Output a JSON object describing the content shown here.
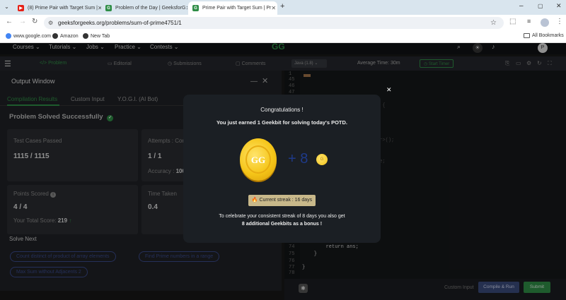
{
  "browser": {
    "tabs": [
      {
        "title": "(8) Prime Pair with Target Sum |",
        "favicon": "youtube-icon",
        "active": false
      },
      {
        "title": "Problem of the Day | GeeksforG",
        "favicon": "gfg-icon",
        "active": false
      },
      {
        "title": "Prime Pair with Target Sum | Pr",
        "favicon": "gfg-icon",
        "active": true
      }
    ],
    "new_tab": "+",
    "url": "geeksforgeeks.org/problems/sum-of-prime4751/1",
    "bookmarks": [
      "www.google.com",
      "Amazon",
      "New Tab"
    ],
    "all_bookmarks": "All Bookmarks"
  },
  "site": {
    "nav": [
      "Courses",
      "Tutorials",
      "Jobs",
      "Practice",
      "Contests"
    ],
    "subtabs": [
      "Problem",
      "Editorial",
      "Submissions",
      "Comments"
    ],
    "output_window": "Output Window",
    "output_tabs": [
      "Compilation Results",
      "Custom Input",
      "Y.O.G.I. (AI Bot)"
    ],
    "result_title": "Problem Solved Successfully",
    "cards": {
      "tests_label": "Test Cases Passed",
      "tests_value": "1115 / 1115",
      "attempts_label": "Attempts : Cor",
      "attempts_value": "1 / 1",
      "accuracy_label": "Accuracy :",
      "accuracy_value": "100",
      "points_label": "Points Scored",
      "points_value": "4 / 4",
      "total_label": "Your Total Score:",
      "total_value": "219",
      "time_label": "Time Taken",
      "time_value": "0.4"
    },
    "solve_next": "Solve Next",
    "suggestions": [
      "Count distinct of product of array elements",
      "Find Prime numbers in a range",
      "Max Sum without Adjacents 2"
    ],
    "editor": {
      "language": "Java (1.8)",
      "avg_time": "Average Time: 30m",
      "start_timer": "Start Timer",
      "lines": [
        {
          "n": "1",
          "text": ""
        },
        {
          "n": "45",
          "text": ""
        },
        {
          "n": "46",
          "text": ""
        },
        {
          "n": "47",
          "text": ""
        },
        {
          "n": "",
          "text": "<Integer> getPrimes(int n) {"
        },
        {
          "n": "",
          "text": "ew boolean[n+1];"
        },
        {
          "n": "",
          "text": "rue);"
        },
        {
          "n": "",
          "text": "ans = new ArrayList<Integer>();"
        },
        {
          "n": "",
          "text": ";i++) {"
        },
        {
          "n": "",
          "text": "*i;j<=n;j+=i)prime[j]=false;"
        },
        {
          "n": "",
          "text": "){"
        },
        {
          "n": "",
          "text": "prime[n-i]){"
        },
        {
          "n": "",
          "text": ");"
        },
        {
          "n": "73",
          "text": "        ans.add(-1);"
        },
        {
          "n": "74",
          "text": "        return ans;"
        },
        {
          "n": "75",
          "text": "    }"
        },
        {
          "n": "76",
          "text": ""
        },
        {
          "n": "77",
          "text": "}"
        },
        {
          "n": "78",
          "text": ""
        }
      ],
      "custom_input": "Custom Input",
      "compile_run": "Compile & Run",
      "submit": "Submit"
    }
  },
  "modal": {
    "close": "✕",
    "title": "Congratulations !",
    "subtitle": "You just earned 1 Geekbit for solving today's POTD.",
    "bonus": "+ 8",
    "streak": "Current streak : 16 days",
    "note_line1": "To celebrate your consistent streak of 8 days you also get",
    "note_line2": "8 additional Geekbits as a bonus !"
  },
  "colors": {
    "accent": "#2f8d46",
    "coin": "#f2c21b",
    "blue": "#1e3a8a"
  }
}
